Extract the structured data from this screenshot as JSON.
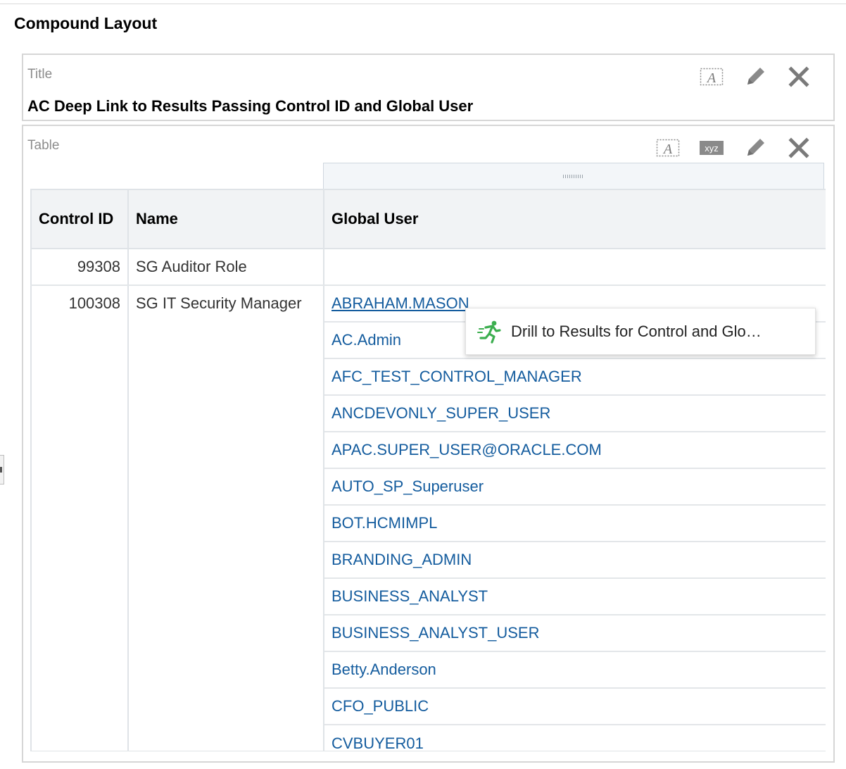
{
  "layout": {
    "section_title": "Compound Layout"
  },
  "title_view": {
    "label": "Title",
    "report_title": "AC Deep Link to Results Passing Control ID and Global User",
    "tools": [
      "format-text-icon",
      "pencil-icon",
      "close-icon"
    ]
  },
  "table_view": {
    "label": "Table",
    "tools": [
      "format-text-icon",
      "xyz-icon",
      "pencil-icon",
      "close-icon"
    ],
    "columns": [
      "Control ID",
      "Name",
      "Global User"
    ],
    "rows": [
      {
        "control_id": "99308",
        "name": "SG Auditor Role",
        "users": [
          ""
        ]
      },
      {
        "control_id": "100308",
        "name": "SG IT Security Manager",
        "users": [
          "ABRAHAM.MASON",
          "AC.Admin",
          "AFC_TEST_CONTROL_MANAGER",
          "ANCDEVONLY_SUPER_USER",
          "APAC.SUPER_USER@ORACLE.COM",
          "AUTO_SP_Superuser",
          "BOT.HCMIMPL",
          "BRANDING_ADMIN",
          "BUSINESS_ANALYST",
          "BUSINESS_ANALYST_USER",
          "Betty.Anderson",
          "CFO_PUBLIC",
          "CVBUYER01"
        ]
      }
    ],
    "link_color": "#145c9e"
  },
  "context_menu": {
    "item_label": "Drill to Results for Control and Glo…",
    "item_icon": "running-figure-icon",
    "icon_color": "#3cae4f"
  }
}
